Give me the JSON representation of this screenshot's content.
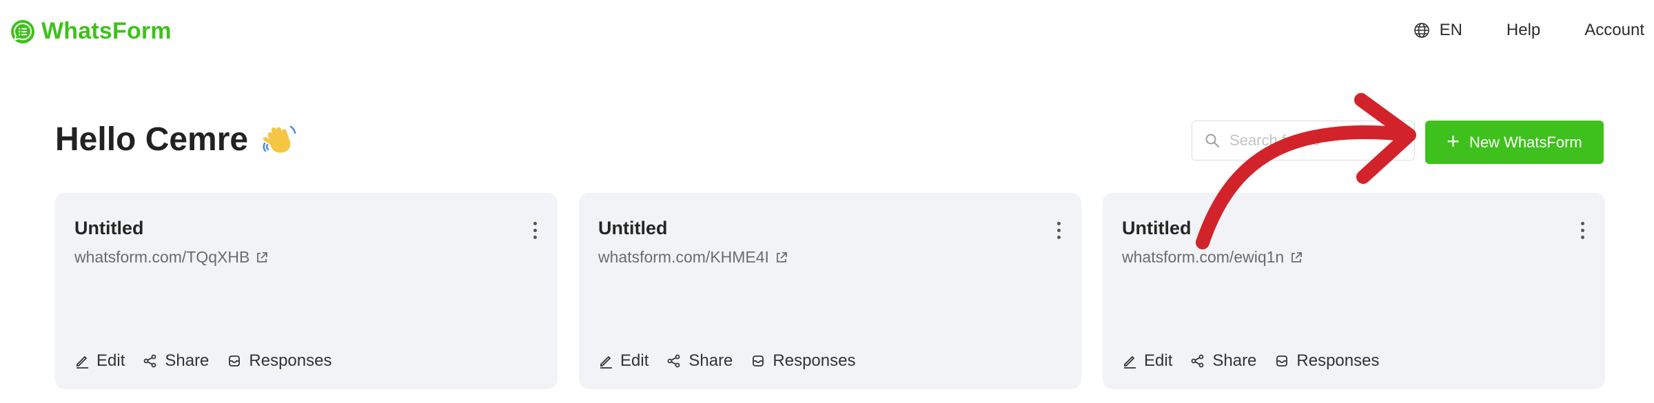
{
  "header": {
    "brand_name": "WhatsForm",
    "brand_color": "#3ec11c",
    "language": "EN",
    "help": "Help",
    "account": "Account"
  },
  "greeting": {
    "text": "Hello Cemre",
    "emoji_icon": "waving-hand-icon"
  },
  "search": {
    "placeholder": "Search forms"
  },
  "new_button": {
    "label": "New WhatsForm"
  },
  "cards": [
    {
      "title": "Untitled",
      "link": "whatsform.com/TQqXHB",
      "actions": {
        "edit": "Edit",
        "share": "Share",
        "responses": "Responses"
      }
    },
    {
      "title": "Untitled",
      "link": "whatsform.com/KHME4I",
      "actions": {
        "edit": "Edit",
        "share": "Share",
        "responses": "Responses"
      }
    },
    {
      "title": "Untitled",
      "link": "whatsform.com/ewiq1n",
      "actions": {
        "edit": "Edit",
        "share": "Share",
        "responses": "Responses"
      }
    }
  ],
  "annotation": {
    "arrow_color": "#d3232a",
    "arrow_target": "new-whatsform-button"
  }
}
